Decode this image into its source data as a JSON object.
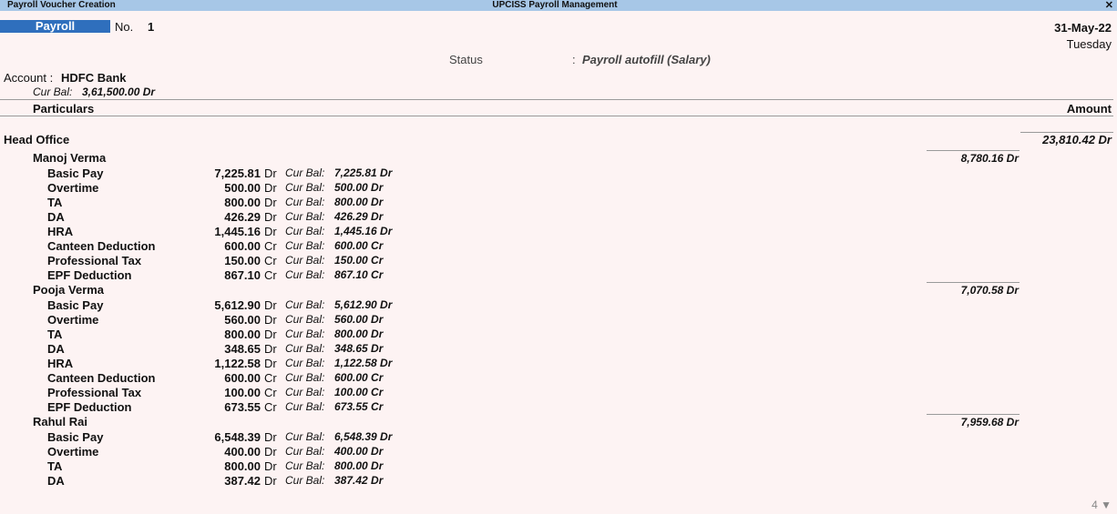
{
  "titlebar": {
    "left": "Payroll Voucher Creation",
    "center": "UPCISS Payroll Management",
    "close": "✕"
  },
  "voucher": {
    "type": "Payroll",
    "no_label": "No.",
    "no_value": "1",
    "date": "31-May-22",
    "day": "Tuesday",
    "status_label": "Status",
    "status_sep": ":",
    "status_value": "Payroll autofill (Salary)"
  },
  "account": {
    "label": "Account :",
    "value": "HDFC Bank",
    "curbal_label": "Cur Bal:",
    "curbal_value": "3,61,500.00 Dr"
  },
  "columns": {
    "particulars": "Particulars",
    "amount": "Amount"
  },
  "group": {
    "name": "Head Office",
    "amount": "23,810.42 Dr"
  },
  "employees": [
    {
      "name": "Manoj Verma",
      "total": "8,780.16 Dr",
      "items": [
        {
          "name": "Basic Pay",
          "amount": "7,225.81",
          "drcr": "Dr",
          "cb_label": "Cur Bal:",
          "cb_value": "7,225.81 Dr"
        },
        {
          "name": "Overtime",
          "amount": "500.00",
          "drcr": "Dr",
          "cb_label": "Cur Bal:",
          "cb_value": "500.00 Dr"
        },
        {
          "name": "TA",
          "amount": "800.00",
          "drcr": "Dr",
          "cb_label": "Cur Bal:",
          "cb_value": "800.00 Dr"
        },
        {
          "name": "DA",
          "amount": "426.29",
          "drcr": "Dr",
          "cb_label": "Cur Bal:",
          "cb_value": "426.29 Dr"
        },
        {
          "name": "HRA",
          "amount": "1,445.16",
          "drcr": "Dr",
          "cb_label": "Cur Bal:",
          "cb_value": "1,445.16 Dr"
        },
        {
          "name": "Canteen Deduction",
          "amount": "600.00",
          "drcr": "Cr",
          "cb_label": "Cur Bal:",
          "cb_value": "600.00 Cr"
        },
        {
          "name": "Professional Tax",
          "amount": "150.00",
          "drcr": "Cr",
          "cb_label": "Cur Bal:",
          "cb_value": "150.00 Cr"
        },
        {
          "name": "EPF Deduction",
          "amount": "867.10",
          "drcr": "Cr",
          "cb_label": "Cur Bal:",
          "cb_value": "867.10 Cr"
        }
      ]
    },
    {
      "name": "Pooja Verma",
      "total": "7,070.58 Dr",
      "items": [
        {
          "name": "Basic Pay",
          "amount": "5,612.90",
          "drcr": "Dr",
          "cb_label": "Cur Bal:",
          "cb_value": "5,612.90 Dr"
        },
        {
          "name": "Overtime",
          "amount": "560.00",
          "drcr": "Dr",
          "cb_label": "Cur Bal:",
          "cb_value": "560.00 Dr"
        },
        {
          "name": "TA",
          "amount": "800.00",
          "drcr": "Dr",
          "cb_label": "Cur Bal:",
          "cb_value": "800.00 Dr"
        },
        {
          "name": "DA",
          "amount": "348.65",
          "drcr": "Dr",
          "cb_label": "Cur Bal:",
          "cb_value": "348.65 Dr"
        },
        {
          "name": "HRA",
          "amount": "1,122.58",
          "drcr": "Dr",
          "cb_label": "Cur Bal:",
          "cb_value": "1,122.58 Dr"
        },
        {
          "name": "Canteen Deduction",
          "amount": "600.00",
          "drcr": "Cr",
          "cb_label": "Cur Bal:",
          "cb_value": "600.00 Cr"
        },
        {
          "name": "Professional Tax",
          "amount": "100.00",
          "drcr": "Cr",
          "cb_label": "Cur Bal:",
          "cb_value": "100.00 Cr"
        },
        {
          "name": "EPF Deduction",
          "amount": "673.55",
          "drcr": "Cr",
          "cb_label": "Cur Bal:",
          "cb_value": "673.55 Cr"
        }
      ]
    },
    {
      "name": "Rahul Rai",
      "total": "7,959.68 Dr",
      "items": [
        {
          "name": "Basic Pay",
          "amount": "6,548.39",
          "drcr": "Dr",
          "cb_label": "Cur Bal:",
          "cb_value": "6,548.39 Dr"
        },
        {
          "name": "Overtime",
          "amount": "400.00",
          "drcr": "Dr",
          "cb_label": "Cur Bal:",
          "cb_value": "400.00 Dr"
        },
        {
          "name": "TA",
          "amount": "800.00",
          "drcr": "Dr",
          "cb_label": "Cur Bal:",
          "cb_value": "800.00 Dr"
        },
        {
          "name": "DA",
          "amount": "387.42",
          "drcr": "Dr",
          "cb_label": "Cur Bal:",
          "cb_value": "387.42 Dr"
        }
      ]
    }
  ],
  "page_indicator": "4 ▼"
}
